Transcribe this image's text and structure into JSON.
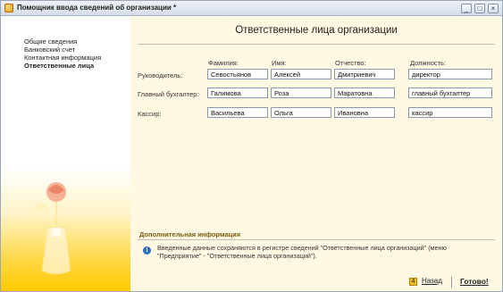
{
  "window": {
    "title": "Помощник ввода сведений об организации *"
  },
  "title_buttons": [
    "_",
    "□",
    "×"
  ],
  "sidebar": {
    "items": [
      {
        "label": "Общие сведения"
      },
      {
        "label": "Банковский счет"
      },
      {
        "label": "Контактная информация"
      },
      {
        "label": "Ответственные лица"
      }
    ]
  },
  "main": {
    "title": "Ответственные лица организации",
    "columns": {
      "last_name": "Фамилия:",
      "first_name": "Имя:",
      "patronymic": "Отчество:",
      "position": "Должность:"
    },
    "rows": [
      {
        "label": "Руководитель:",
        "last_name": "Севостьянов",
        "first_name": "Алексей",
        "patronymic": "Дмитриевич",
        "position": "директор"
      },
      {
        "label": "Главный бухгалтер:",
        "last_name": "Галимова",
        "first_name": "Роза",
        "patronymic": "Маратовна",
        "position": "главный бухгалтер"
      },
      {
        "label": "Кассир:",
        "last_name": "Васильева",
        "first_name": "Ольга",
        "patronymic": "Ивановна",
        "position": "кассир"
      }
    ],
    "additional": {
      "title": "Дополнительная информация",
      "text": "Введенные данные сохраняются в регистре сведений \"Ответственные лица организаций\" (меню \"Предприятие\" - \"Ответственные лица организаций\")."
    }
  },
  "footer": {
    "back_number": "4",
    "back_label": "Назад",
    "done_label": "Готово!"
  }
}
